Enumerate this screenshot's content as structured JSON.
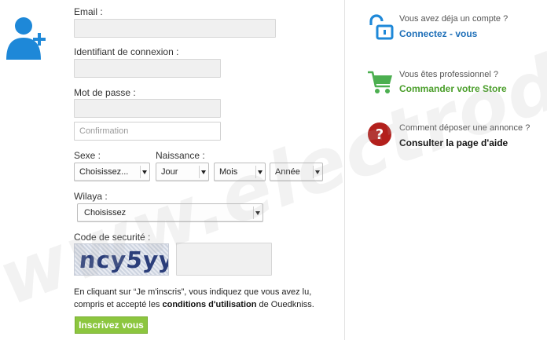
{
  "form": {
    "email": {
      "label": "Email :",
      "value": ""
    },
    "login": {
      "label": "Identifiant de connexion :",
      "value": ""
    },
    "password": {
      "label": "Mot de passe :",
      "value": "",
      "confirm_placeholder": "Confirmation"
    },
    "sexe": {
      "label": "Sexe :",
      "selected": "Choisissez..."
    },
    "naissance": {
      "label": "Naissance :",
      "day": "Jour",
      "month": "Mois",
      "year": "Année"
    },
    "wilaya": {
      "label": "Wilaya :",
      "selected": "Choisissez"
    },
    "security": {
      "label": "Code de securité :",
      "captcha_text": "ncy5yy",
      "value": ""
    },
    "terms": {
      "line1": "En cliquant sur “Je m'inscris”, vous indiquez que vous avez lu,",
      "line2_prefix": "compris et accepté les ",
      "link": "conditions d'utilisation",
      "line2_suffix": " de Ouedkniss."
    },
    "submit_label": "Inscrivez vous"
  },
  "sidebar": {
    "account": {
      "subtitle": "Vous avez déja un compte ?",
      "link": "Connectez - vous",
      "link_color": "#1e6fb8",
      "icon": "unlock-icon"
    },
    "pro": {
      "subtitle": "Vous êtes professionnel ?",
      "link": "Commander votre Store",
      "link_color": "#4a9e2a",
      "icon": "shopping-cart-icon"
    },
    "help": {
      "subtitle": "Comment déposer une annonce ?",
      "link": "Consulter la page d'aide",
      "link_color": "#111111",
      "icon": "question-icon"
    }
  },
  "watermark": "www.electrodz.com",
  "colors": {
    "accent_blue": "#1e6fb8",
    "accent_green": "#8cc63f",
    "help_red": "#b3201c"
  }
}
